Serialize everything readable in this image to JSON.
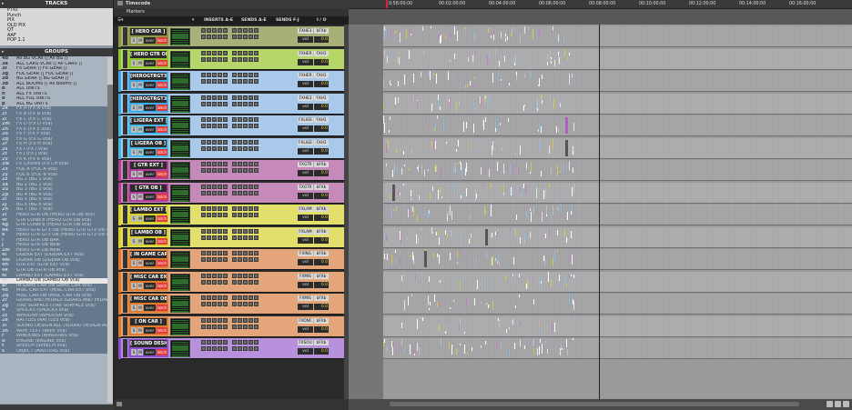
{
  "tracks_panel": {
    "title": "TRACKS",
    "items": [
      "PTIO",
      "Punch",
      "PIX",
      "OLD PIX",
      "QT",
      "AAF",
      "POP 1.1"
    ]
  },
  "groups_panel": {
    "title": "GROUPS",
    "items": [
      {
        "id": "4d",
        "name": "All BG VCAs (| All BG |)"
      },
      {
        "id": "3e",
        "name": "ALL CARS VCAs (| All CARS |)"
      },
      {
        "id": "3f",
        "name": "FX GEAR (| FX GEAR |)"
      },
      {
        "id": "3g",
        "name": "FOL GEAR (| FOL GEAR |)"
      },
      {
        "id": "3d",
        "name": "BG GEAR (| BG GEAR |)"
      },
      {
        "id": "3b",
        "name": "ALL BOOMS (| All Booms |)"
      },
      {
        "id": "b",
        "name": "ALL UNITS"
      },
      {
        "id": "n",
        "name": "ALL FX UNITS"
      },
      {
        "id": "o",
        "name": "ALL FOL UNITS"
      },
      {
        "id": "p",
        "name": "ALL BG UNITS"
      },
      {
        "id": "2k",
        "name": "FX A (FX A vca)"
      },
      {
        "id": "2l",
        "name": "FX B (FX B vca)"
      },
      {
        "id": "2l",
        "name": "FX C (FX C vca)"
      },
      {
        "id": "2m",
        "name": "FX D (FX D vca)"
      },
      {
        "id": "2n",
        "name": "FX E (FX E vca)"
      },
      {
        "id": "2o",
        "name": "FX F (FX F vca)"
      },
      {
        "id": "2q",
        "name": "FX G (FX G vca)"
      },
      {
        "id": "2r",
        "name": "FX H (FX H vca)"
      },
      {
        "id": "2s",
        "name": "FX I (FX I vca)"
      },
      {
        "id": "2t",
        "name": "FX J (FX J vca)"
      },
      {
        "id": "2v",
        "name": "FX K (FX K vca)"
      },
      {
        "id": "2w",
        "name": "FX Chunck (FX CH vca)"
      },
      {
        "id": "2x",
        "name": "FOL A (FOL A vca)"
      },
      {
        "id": "2y",
        "name": "FOL B (FOL B vca)"
      },
      {
        "id": "2z",
        "name": "BG 1 (BG 1 vca)"
      },
      {
        "id": "3a",
        "name": "BG 2 (BG 2 vca)"
      },
      {
        "id": "2u",
        "name": "BG 3 (BG 3 vca)"
      },
      {
        "id": "2p",
        "name": "BG 4 (BG 4 vca)"
      },
      {
        "id": "2i",
        "name": "BG 5 (BG 5 vca)"
      },
      {
        "id": "2j",
        "name": "BG 6 (BG 6 vca)"
      },
      {
        "id": "2h",
        "name": "BG 7 (BG 7 vca)"
      },
      {
        "id": "2i",
        "name": "HERO GTR OB (HERO GTR OB vca)"
      },
      {
        "id": "4f",
        "name": "GTR CONN 8 (HERO GTR OB vca)"
      },
      {
        "id": "4g",
        "name": "GTR CONN 8 (HERO GTR OB vca)"
      },
      {
        "id": "4e",
        "name": "HERO GTR GT3 OB (HERO GTR GT3 OB vca)"
      },
      {
        "id": "k",
        "name": "HERO GTR GT3 OB (HERO GTR GT3 OB vca)"
      },
      {
        "id": "l",
        "name": "HERO GTR OB BAR"
      },
      {
        "id": "j",
        "name": "HERO GTR OB NoiR"
      },
      {
        "id": "2m",
        "name": "HERO GTR OB NoiR"
      },
      {
        "id": "4i",
        "name": "LIGERA EXT (LIGERA EXT vca)"
      },
      {
        "id": "4m",
        "name": "LIGERA OB (LIGERA OB vca)"
      },
      {
        "id": "4h",
        "name": "GTR EXT (GTR EXT vca)"
      },
      {
        "id": "4k",
        "name": "GTR OB (GTR OB vca)"
      },
      {
        "id": "4l",
        "name": "LAMBO EXT (LAMBO EXT vca)"
      },
      {
        "id": "4j",
        "name": "LAMBO OB (LAMBO OB vca)"
      },
      {
        "id": "ar",
        "name": "IN GAME CAR (IN GAME CAR vca)"
      },
      {
        "id": "4o",
        "name": "MISC CAR EXT (MISC CAR EXT vca)"
      },
      {
        "id": "2q",
        "name": "MISC CAR OB (MISC CAR OB vca)"
      },
      {
        "id": "2f",
        "name": "GEARS AND PEDALS (GEARS AND PEDALS vca)"
      },
      {
        "id": "2g",
        "name": "TIRE SURFACE (TIRE SURFACE vca)"
      },
      {
        "id": "4",
        "name": "SHOCKS (SHOCKS vca)"
      },
      {
        "id": "2c",
        "name": "WHOOSH (WHOOSH vca)"
      },
      {
        "id": "2e",
        "name": "RATTLES (RATTLES vca)"
      },
      {
        "id": "3i",
        "name": "SOUND DESIGN ALL (SOUND DESIGN ALL vca)"
      },
      {
        "id": "3h",
        "name": "WIPE TEXT (WIPE vca)"
      },
      {
        "id": "r",
        "name": "WINDOWS (WINDOWS vca)"
      },
      {
        "id": "u",
        "name": "ENGINE (ENGINE vca)"
      },
      {
        "id": "t",
        "name": "SPEECH (SPEECH vca)"
      },
      {
        "id": "s",
        "name": "OBJECT (MASTERS vca)"
      }
    ]
  },
  "edit_window": {
    "ruler_label": "Timecode",
    "markers_label": "Markers",
    "columns": {
      "inserts": "INSERTS A-E",
      "sends_ae": "SENDS A-E",
      "sends_fj": "SENDS F-J",
      "io": "I / O"
    },
    "timecodes": [
      "0:58:00:00",
      "00:02:00:00",
      "00:04:00:00",
      "00:06:00:00",
      "00:08:00:00",
      "00:10:00:00",
      "00:12:00:00",
      "00:14:00:00",
      "00:16:00:00"
    ]
  },
  "tracks": [
    {
      "name": "[ HERO CAR ]",
      "output": "FXHE3",
      "bus": "bFXb",
      "vol_label": "vol",
      "vol": "0.0",
      "color": "#a8b07a",
      "nbox": "#8f963f",
      "mode": "over",
      "auto": "latch"
    },
    {
      "name": "[ HERO GTR OB ]",
      "output": "FXHER",
      "bus": "FXH1",
      "vol_label": "vol",
      "vol": "0.0",
      "color": "#b7d66a",
      "nbox": "#8fc42c",
      "mode": "over",
      "auto": "latch"
    },
    {
      "name": "[HEROGTRGT3EX",
      "output": "FXHER",
      "bus": "FXH1",
      "vol_label": "vol",
      "vol": "0.0",
      "color": "#a8c9ea",
      "nbox": "#3fa8e6",
      "mode": "over",
      "auto": "latch"
    },
    {
      "name": "[HEROGTRGT3OB",
      "output": "FXHE3",
      "bus": "FXH1",
      "vol_label": "vol",
      "vol": "0.0",
      "color": "#a8c9ea",
      "nbox": "#3fa8e6",
      "mode": "over",
      "auto": "latch"
    },
    {
      "name": "[ LIGERA EXT ]",
      "output": "FXLIGE",
      "bus": "FXH1",
      "vol_label": "vol",
      "vol": "0.0",
      "color": "#a8c9ea",
      "nbox": "#43b8e6",
      "mode": "over",
      "auto": "latch"
    },
    {
      "name": "[ LIGERA OB ]",
      "output": "FXLIGE",
      "bus": "FXH1",
      "vol_label": "vol",
      "vol": "0.0",
      "color": "#a8c9ea",
      "nbox": "#43b8e6",
      "mode": "over",
      "auto": "latch"
    },
    {
      "name": "[ GTR EXT ]",
      "output": "FXGTR",
      "bus": "bFXb",
      "vol_label": "vol",
      "vol": "0.0",
      "color": "#c58ab9",
      "nbox": "#b03e9a",
      "mode": "over",
      "auto": "latch"
    },
    {
      "name": "[ GTR OB ]",
      "output": "FXGTR",
      "bus": "bFXb",
      "vol_label": "vol",
      "vol": "0.0",
      "color": "#c58ab9",
      "nbox": "#b03e9a",
      "mode": "over",
      "auto": "latch"
    },
    {
      "name": "[ LAMBO EXT ]",
      "output": "FXLAM",
      "bus": "bFXb",
      "vol_label": "vol",
      "vol": "0.0",
      "color": "#e2df6c",
      "nbox": "#d8d228",
      "mode": "over",
      "auto": "latch"
    },
    {
      "name": "[ LAMBO OB ]",
      "output": "FXLAM",
      "bus": "bFXb",
      "vol_label": "vol",
      "vol": "0.0",
      "color": "#e2df6c",
      "nbox": "#d8d228",
      "mode": "over",
      "auto": "latch"
    },
    {
      "name": "[ IN GAME CAR ]",
      "output": "FXING",
      "bus": "bFXb",
      "vol_label": "vol",
      "vol": "0.0",
      "color": "#e5a57a",
      "nbox": "#e07a2c",
      "mode": "over",
      "auto": "latch"
    },
    {
      "name": "[ MISC CAR EXT ]",
      "output": "FXMIS",
      "bus": "bFXb",
      "vol_label": "vol",
      "vol": "0.0",
      "color": "#e5a57a",
      "nbox": "#e07a2c",
      "mode": "over",
      "auto": "latch"
    },
    {
      "name": "[ MISC CAR OB ]",
      "output": "FXMIS",
      "bus": "bFXb",
      "vol_label": "vol",
      "vol": "0.0",
      "color": "#e5a57a",
      "nbox": "#e07a2c",
      "mode": "over",
      "auto": "latch"
    },
    {
      "name": "[ ON CAR ]",
      "output": "FXONC",
      "bus": "bFXb",
      "vol_label": "vol",
      "vol": "0.0",
      "color": "#e5a57a",
      "nbox": "#e07a2c",
      "mode": "over",
      "auto": "latch"
    },
    {
      "name": "[ SOUND DESIGN ]",
      "output": "FXSOU",
      "bus": "bFXb",
      "vol_label": "vol",
      "vol": "0.0",
      "color": "#b891dd",
      "nbox": "#8f4fd1",
      "mode": "over",
      "auto": "latch"
    }
  ],
  "buttons": {
    "solo": "S",
    "mute": "M"
  }
}
